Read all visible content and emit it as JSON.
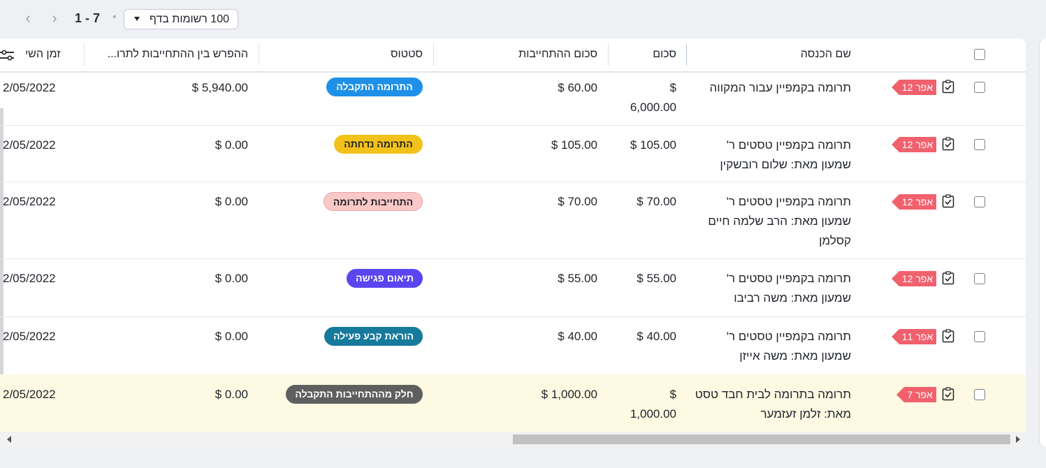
{
  "pagination": {
    "range": "1 - 7",
    "per_page": "100 רשומות בדף"
  },
  "columns": {
    "income_name": "שם הכנסה",
    "amount": "סכום",
    "commitment_amount": "סכום ההתחייבות",
    "status": "סטטוס",
    "difference": "ההפרש בין ההתחייבות לתרו...",
    "time": "זמן השי"
  },
  "rows": [
    {
      "date_tag": "אפר 12",
      "name_line1": "תרומה בקמפיין עבור המקווה",
      "name_line2": "",
      "name_line3": "",
      "amount_line1": "$",
      "amount_line2": "6,000.00",
      "commitment": "60.00 $",
      "status": "התרומה התקבלה",
      "status_bg": "#1e90e8",
      "status_fg": "#ffffff",
      "difference": "5,940.00 $",
      "date": "2/05/2022"
    },
    {
      "date_tag": "אפר 12",
      "name_line1": "תרומה בקמפיין טסטים ר'",
      "name_line2": "שמעון מאת: שלום רובשקין",
      "name_line3": "",
      "amount_line1": "105.00 $",
      "amount_line2": "",
      "commitment": "105.00 $",
      "status": "התרומה נדחתה",
      "status_bg": "#f2c21a",
      "status_fg": "#222222",
      "difference": "0.00 $",
      "date": "2/05/2022"
    },
    {
      "date_tag": "אפר 12",
      "name_line1": "תרומה בקמפיין טסטים ר'",
      "name_line2": "שמעון מאת: הרב שלמה חיים",
      "name_line3": "קסלמן",
      "amount_line1": "70.00 $",
      "amount_line2": "",
      "commitment": "70.00 $",
      "status": "התחייבות לתרומה",
      "status_bg": "#fbc8c8",
      "status_fg": "#222222",
      "difference": "0.00 $",
      "date": "2/05/2022"
    },
    {
      "date_tag": "אפר 12",
      "name_line1": "תרומה בקמפיין טסטים ר'",
      "name_line2": "שמעון מאת: משה רביבו",
      "name_line3": "",
      "amount_line1": "55.00 $",
      "amount_line2": "",
      "commitment": "55.00 $",
      "status": "תיאום פגישה",
      "status_bg": "#5b45f0",
      "status_fg": "#ffffff",
      "difference": "0.00 $",
      "date": "2/05/2022"
    },
    {
      "date_tag": "אפר 11",
      "name_line1": "תרומה בקמפיין טסטים ר'",
      "name_line2": "שמעון מאת: משה אייזן",
      "name_line3": "",
      "amount_line1": "40.00 $",
      "amount_line2": "",
      "commitment": "40.00 $",
      "status": "הוראת קבע פעילה",
      "status_bg": "#157a9b",
      "status_fg": "#ffffff",
      "difference": "0.00 $",
      "date": "2/05/2022"
    },
    {
      "date_tag": "אפר 7",
      "name_line1": "תרומה בתרומה לבית חבד טסט",
      "name_line2": "מאת: זלמן זעזמער",
      "name_line3": "",
      "amount_line1": "$",
      "amount_line2": "1,000.00",
      "commitment": "1,000.00 $",
      "status": "חלק מההתחייבות התקבלה",
      "status_bg": "#5f5f5f",
      "status_fg": "#ffffff",
      "difference": "0.00 $",
      "date": "2/05/2022"
    }
  ]
}
